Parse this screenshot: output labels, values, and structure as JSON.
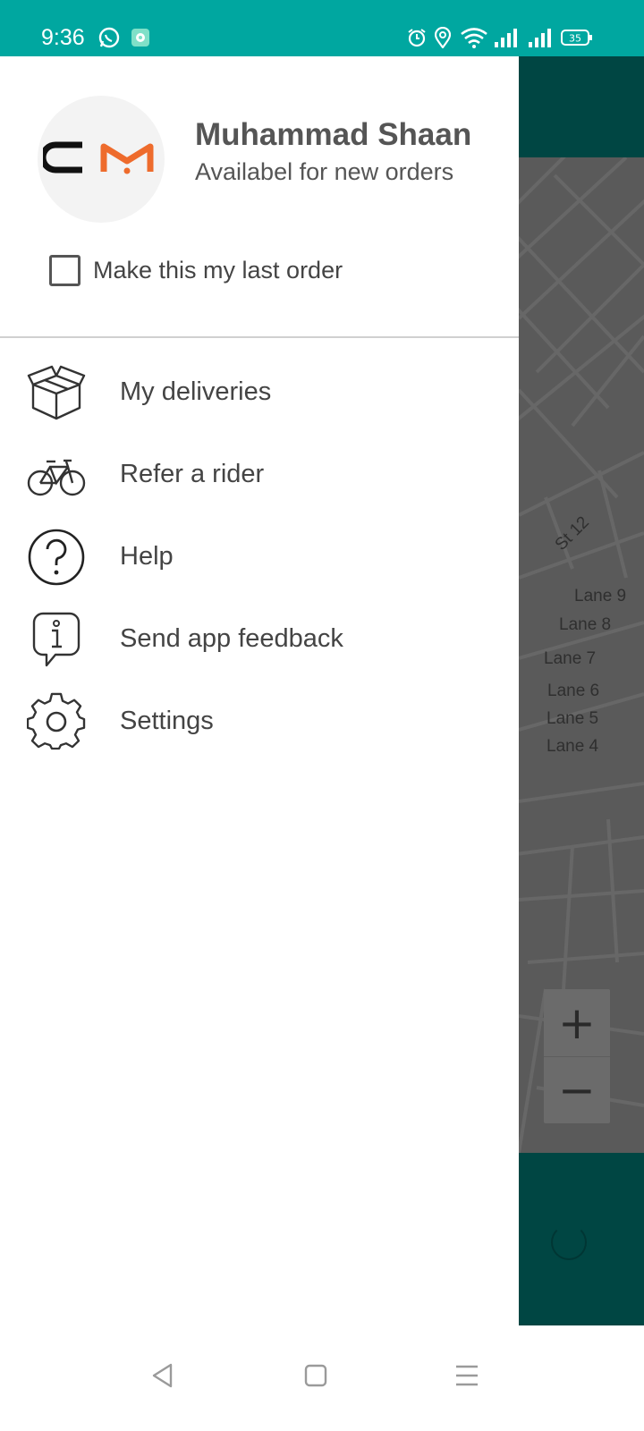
{
  "status_bar": {
    "time": "9:36",
    "battery": "35",
    "icons": [
      "whatsapp-icon",
      "chat-app-icon",
      "alarm-icon",
      "location-icon",
      "wifi-icon",
      "signal-icon",
      "signal-icon",
      "battery-icon"
    ],
    "background_color": "#00a7a0"
  },
  "drawer": {
    "profile": {
      "name": "Muhammad Shaan",
      "status": "Availabel for new orders",
      "avatar_logo": "cm-logo"
    },
    "last_order_checkbox": {
      "label": "Make this my last order",
      "checked": false
    },
    "menu": [
      {
        "label": "My deliveries",
        "icon": "box-icon"
      },
      {
        "label": "Refer a rider",
        "icon": "bicycle-icon"
      },
      {
        "label": "Help",
        "icon": "question-icon"
      },
      {
        "label": "Send app feedback",
        "icon": "info-feedback-icon"
      },
      {
        "label": "Settings",
        "icon": "gear-icon"
      }
    ]
  },
  "background_map": {
    "street_labels": [
      "St 12",
      "Lane 9",
      "Lane 8",
      "Lane 7",
      "Lane 6",
      "Lane 5",
      "Lane 4"
    ],
    "zoom_in": "+",
    "zoom_out": "−",
    "header_color": "#004643"
  },
  "nav_bar": {
    "buttons": [
      "back-icon",
      "home-icon",
      "recents-icon"
    ]
  }
}
